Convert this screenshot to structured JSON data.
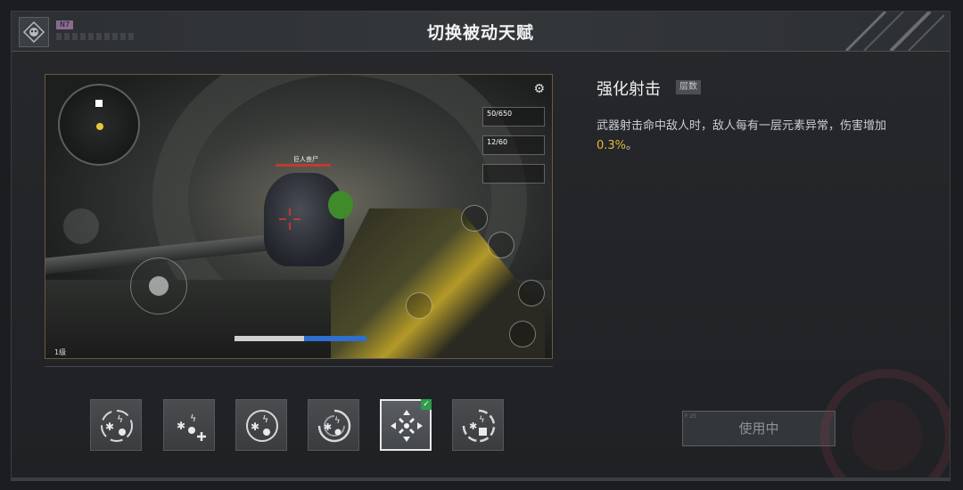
{
  "header": {
    "title": "切换被动天赋",
    "badge": "N7"
  },
  "preview": {
    "enemy_label": "巨人丧尸",
    "level_label": "1级",
    "weapons": [
      {
        "ammo": "50/650"
      },
      {
        "ammo": "12/60"
      },
      {
        "ammo": ""
      }
    ]
  },
  "talent": {
    "name": "强化射击",
    "tag": "层数",
    "description": "武器射击命中敌人时，敌人每有一层元素异常，伤害增加",
    "value": "0.3%",
    "value_suffix": "。"
  },
  "slots": [
    {
      "icon": "element-lightning-burst-icon"
    },
    {
      "icon": "element-lightning-plus-icon"
    },
    {
      "icon": "element-circle-icon"
    },
    {
      "icon": "element-swirl-icon"
    },
    {
      "icon": "precision-shot-icon",
      "selected": true
    },
    {
      "icon": "element-shield-icon"
    }
  ],
  "use_button": {
    "label": "使用中",
    "corner": "F 25"
  },
  "colors": {
    "accent_value": "#e6b93a",
    "selected_border": "#e6e8ea",
    "check": "#2f9b4c"
  }
}
